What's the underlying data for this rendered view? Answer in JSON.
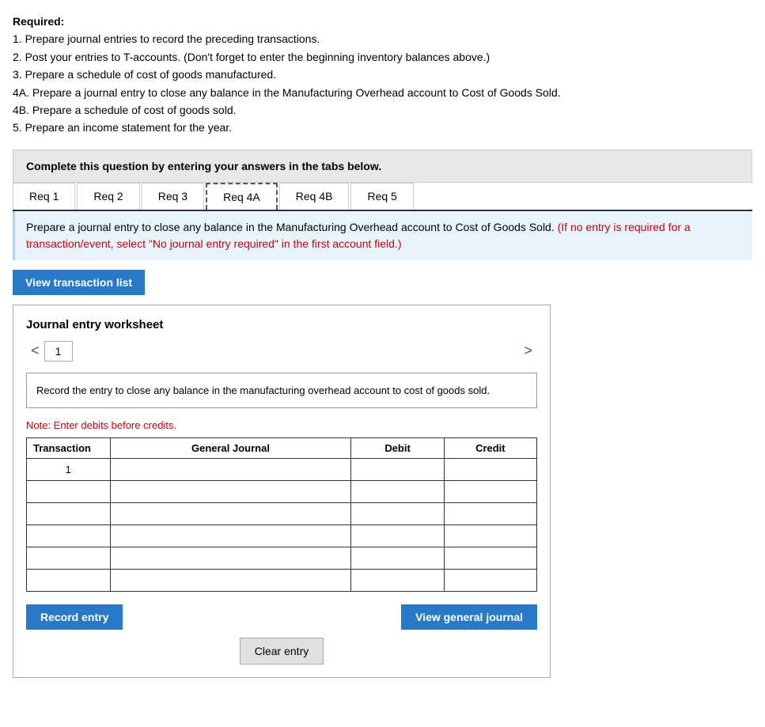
{
  "required": {
    "title": "Required:",
    "items": [
      "1. Prepare journal entries to record the preceding transactions.",
      "2. Post your entries to T-accounts. (Don't forget to enter the beginning inventory balances above.)",
      "3. Prepare a schedule of cost of goods manufactured.",
      "4A. Prepare a journal entry to close any balance in the Manufacturing Overhead account to Cost of Goods Sold.",
      "4B. Prepare a schedule of cost of goods sold.",
      "5. Prepare an income statement for the year."
    ]
  },
  "complete_instruction": "Complete this question by entering your answers in the tabs below.",
  "tabs": [
    {
      "label": "Req 1",
      "active": false
    },
    {
      "label": "Req 2",
      "active": false
    },
    {
      "label": "Req 3",
      "active": false
    },
    {
      "label": "Req 4A",
      "active": true
    },
    {
      "label": "Req 4B",
      "active": false
    },
    {
      "label": "Req 5",
      "active": false
    }
  ],
  "instruction": {
    "main": "Prepare a journal entry to close any balance in the Manufacturing Overhead account to Cost of Goods Sold.",
    "red": "(If no entry is required for a transaction/event, select \"No journal entry required\" in the first account field.)"
  },
  "view_transaction_btn": "View transaction list",
  "journal": {
    "title": "Journal entry worksheet",
    "entry_num": "1",
    "description": "Record the entry to close any balance in the manufacturing overhead account to cost of goods sold.",
    "note": "Note: Enter debits before credits.",
    "table": {
      "headers": [
        "Transaction",
        "General Journal",
        "Debit",
        "Credit"
      ],
      "rows": [
        {
          "transaction": "1",
          "journal": "",
          "debit": "",
          "credit": ""
        },
        {
          "transaction": "",
          "journal": "",
          "debit": "",
          "credit": ""
        },
        {
          "transaction": "",
          "journal": "",
          "debit": "",
          "credit": ""
        },
        {
          "transaction": "",
          "journal": "",
          "debit": "",
          "credit": ""
        },
        {
          "transaction": "",
          "journal": "",
          "debit": "",
          "credit": ""
        },
        {
          "transaction": "",
          "journal": "",
          "debit": "",
          "credit": ""
        }
      ]
    },
    "record_btn": "Record entry",
    "clear_btn": "Clear entry",
    "view_journal_btn": "View general journal"
  },
  "nav": {
    "prev": "<",
    "next": ">"
  }
}
